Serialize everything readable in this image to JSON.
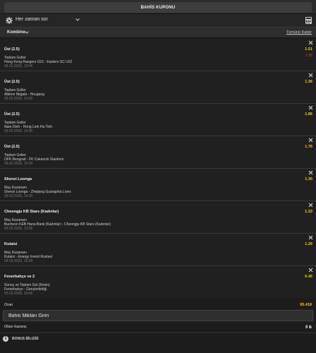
{
  "header": {
    "title": "BAHİS KUPONU"
  },
  "filter": {
    "label": "Her zaman sor",
    "icon": "gear-icon",
    "chevron": "chevron-down-icon",
    "right_icon": "calculator-icon"
  },
  "kombine": {
    "label": "Kombine",
    "remove_all": "Tümünü Kaldır"
  },
  "colors": {
    "accent_yellow": "#f5c518",
    "old_odd_red": "#e0402a",
    "background": "#1e1e1e"
  },
  "bets": [
    {
      "selection": "Üst (2.5)",
      "market": "Toplam Goller",
      "match": "Hong Kong Rangers U22 - Eastern SC U22",
      "date": "09.02.2026, 13:45",
      "odd": "1.51",
      "old_odd": "1.56"
    },
    {
      "selection": "Üst (2.5)",
      "market": "Toplam Goller",
      "match": "Albirex Niigata - Hougang",
      "date": "09.02.2026, 14:30",
      "odd": "1.36",
      "old_odd": ""
    },
    {
      "selection": "Üst (2.5)",
      "market": "Toplam Goller",
      "match": "Nam Dinh - Hong Linh Ha Tinh",
      "date": "09.02.2026, 14:00",
      "odd": "1.86",
      "old_odd": ""
    },
    {
      "selection": "Üst (2.5)",
      "market": "Toplam Goller",
      "match": "OFK Beograd - FK Cukaricki Stankom",
      "date": "09.02.2026, 15:00",
      "odd": "1.76",
      "old_odd": ""
    },
    {
      "selection": "Shenzi Loonga",
      "market": "Maç Kazananı",
      "match": "Shenzi Loonga - Zhejiang Guangsha Lions",
      "date": "09.02.2026, 14:30",
      "odd": "1.30",
      "old_odd": ""
    },
    {
      "selection": "Cheongju KB Stars (Kadınlar)",
      "market": "Maç Kazananı",
      "match": "Bucheon KEB Hana Bank (Kadınlar) - Cheongju KB Stars (Kadınlar)",
      "date": "09.02.2026, 13:00",
      "odd": "1.33",
      "old_odd": ""
    },
    {
      "selection": "Kutaisi",
      "market": "Maç Kazananı",
      "match": "Kutaisi - Energy Invest Rustavi",
      "date": "09.02.2026, 15:00",
      "odd": "1.29",
      "old_odd": ""
    },
    {
      "selection": "Fenerbahçe ve 2",
      "market": "Sonuç ve Toplam Gol (Kesin)",
      "match": "Fenerbahçe - Gençlerbirliği",
      "date": "09.02.2026, 20:00",
      "odd": "6.45",
      "old_odd": ""
    }
  ],
  "summary": {
    "odds_label": "Oran",
    "odds_value": "95.418",
    "stake_placeholder": "Bahis Miktarı Girin",
    "gain_label": "Olası kazanç",
    "gain_value": "0 ₺",
    "bonus_label": "BONUS BİLGİSİ"
  }
}
